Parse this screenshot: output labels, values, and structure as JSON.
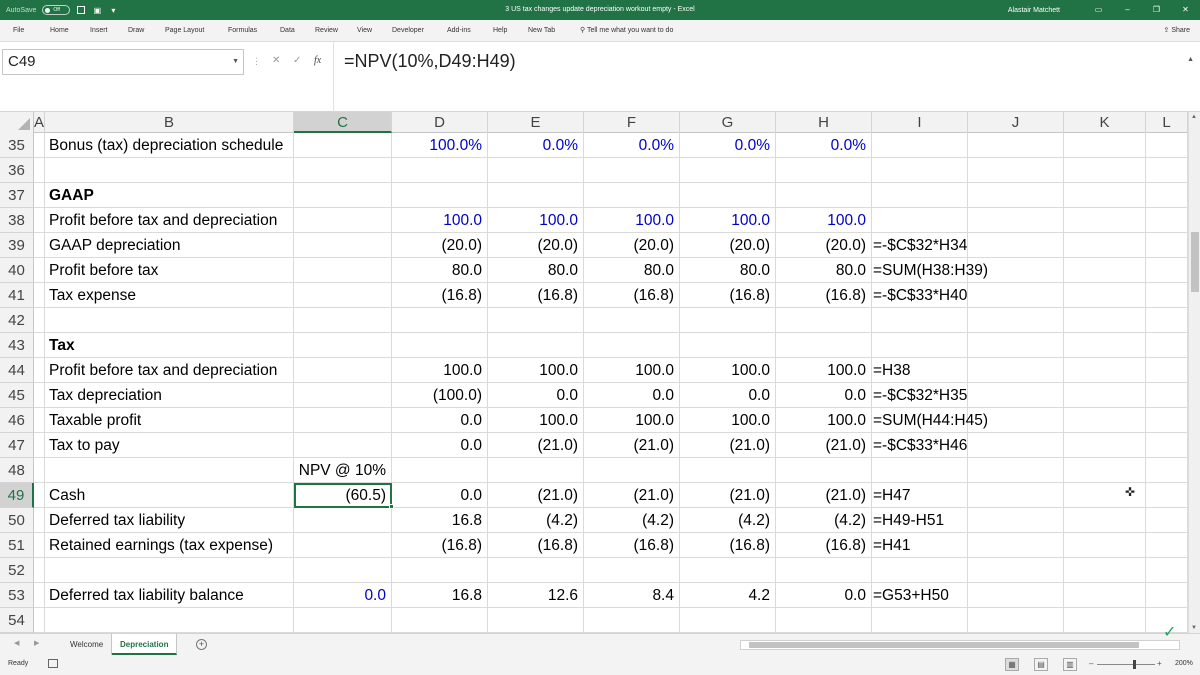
{
  "titlebar": {
    "autosave_label": "AutoSave",
    "autosave_state": "Off",
    "title": "3 US tax changes update depreciation workout empty  -  Excel",
    "user": "Alastair Matchett"
  },
  "ribbon": {
    "tabs": [
      "File",
      "Home",
      "Insert",
      "Draw",
      "Page Layout",
      "Formulas",
      "Data",
      "Review",
      "View",
      "Developer",
      "Add-ins",
      "Help",
      "New Tab"
    ],
    "tell_me": "Tell me what you want to do",
    "share": "Share"
  },
  "formula_bar": {
    "name_box": "C49",
    "formula": "=NPV(10%,D49:H49)"
  },
  "columns": [
    "A",
    "B",
    "C",
    "D",
    "E",
    "F",
    "G",
    "H",
    "I",
    "J",
    "K",
    "L"
  ],
  "selected_column": "C",
  "selected_row": "49",
  "rows": [
    {
      "num": "35",
      "b": "Bonus (tax) depreciation schedule",
      "c": "",
      "d": "100.0%",
      "e": "0.0%",
      "f": "0.0%",
      "g": "0.0%",
      "h": "0.0%",
      "i": ""
    },
    {
      "num": "36",
      "b": "",
      "c": "",
      "d": "",
      "e": "",
      "f": "",
      "g": "",
      "h": "",
      "i": ""
    },
    {
      "num": "37",
      "b": "GAAP",
      "c": "",
      "d": "",
      "e": "",
      "f": "",
      "g": "",
      "h": "",
      "i": ""
    },
    {
      "num": "38",
      "b": "Profit before tax and depreciation",
      "c": "",
      "d": "100.0",
      "e": "100.0",
      "f": "100.0",
      "g": "100.0",
      "h": "100.0",
      "i": ""
    },
    {
      "num": "39",
      "b": "GAAP depreciation",
      "c": "",
      "d": "(20.0)",
      "e": "(20.0)",
      "f": "(20.0)",
      "g": "(20.0)",
      "h": "(20.0)",
      "i": "=-$C$32*H34"
    },
    {
      "num": "40",
      "b": "Profit before tax",
      "c": "",
      "d": "80.0",
      "e": "80.0",
      "f": "80.0",
      "g": "80.0",
      "h": "80.0",
      "i": "=SUM(H38:H39)"
    },
    {
      "num": "41",
      "b": "Tax expense",
      "c": "",
      "d": "(16.8)",
      "e": "(16.8)",
      "f": "(16.8)",
      "g": "(16.8)",
      "h": "(16.8)",
      "i": "=-$C$33*H40"
    },
    {
      "num": "42",
      "b": "",
      "c": "",
      "d": "",
      "e": "",
      "f": "",
      "g": "",
      "h": "",
      "i": ""
    },
    {
      "num": "43",
      "b": "Tax",
      "c": "",
      "d": "",
      "e": "",
      "f": "",
      "g": "",
      "h": "",
      "i": ""
    },
    {
      "num": "44",
      "b": "Profit before tax and depreciation",
      "c": "",
      "d": "100.0",
      "e": "100.0",
      "f": "100.0",
      "g": "100.0",
      "h": "100.0",
      "i": "=H38"
    },
    {
      "num": "45",
      "b": "Tax depreciation",
      "c": "",
      "d": "(100.0)",
      "e": "0.0",
      "f": "0.0",
      "g": "0.0",
      "h": "0.0",
      "i": "=-$C$32*H35"
    },
    {
      "num": "46",
      "b": "Taxable profit",
      "c": "",
      "d": "0.0",
      "e": "100.0",
      "f": "100.0",
      "g": "100.0",
      "h": "100.0",
      "i": "=SUM(H44:H45)"
    },
    {
      "num": "47",
      "b": "Tax to pay",
      "c": "",
      "d": "0.0",
      "e": "(21.0)",
      "f": "(21.0)",
      "g": "(21.0)",
      "h": "(21.0)",
      "i": "=-$C$33*H46"
    },
    {
      "num": "48",
      "b": "",
      "c": "NPV @ 10%",
      "d": "",
      "e": "",
      "f": "",
      "g": "",
      "h": "",
      "i": ""
    },
    {
      "num": "49",
      "b": "Cash",
      "c": "(60.5)",
      "d": "0.0",
      "e": "(21.0)",
      "f": "(21.0)",
      "g": "(21.0)",
      "h": "(21.0)",
      "i": "=H47"
    },
    {
      "num": "50",
      "b": "Deferred tax liability",
      "c": "",
      "d": "16.8",
      "e": "(4.2)",
      "f": "(4.2)",
      "g": "(4.2)",
      "h": "(4.2)",
      "i": "=H49-H51"
    },
    {
      "num": "51",
      "b": "Retained earnings (tax expense)",
      "c": "",
      "d": "(16.8)",
      "e": "(16.8)",
      "f": "(16.8)",
      "g": "(16.8)",
      "h": "(16.8)",
      "i": "=H41"
    },
    {
      "num": "52",
      "b": "",
      "c": "",
      "d": "",
      "e": "",
      "f": "",
      "g": "",
      "h": "",
      "i": ""
    },
    {
      "num": "53",
      "b": "Deferred tax liability balance",
      "c": "0.0",
      "d": "16.8",
      "e": "12.6",
      "f": "8.4",
      "g": "4.2",
      "h": "0.0",
      "i": "=G53+H50"
    },
    {
      "num": "54",
      "b": "",
      "c": "",
      "d": "",
      "e": "",
      "f": "",
      "g": "",
      "h": "",
      "i": ""
    }
  ],
  "sheets": [
    "Welcome",
    "Depreciation"
  ],
  "active_sheet": "Depreciation",
  "status": {
    "ready": "Ready",
    "zoom": "200%"
  },
  "colors": {
    "excel_green": "#217346",
    "input_blue": "#0000cc"
  }
}
